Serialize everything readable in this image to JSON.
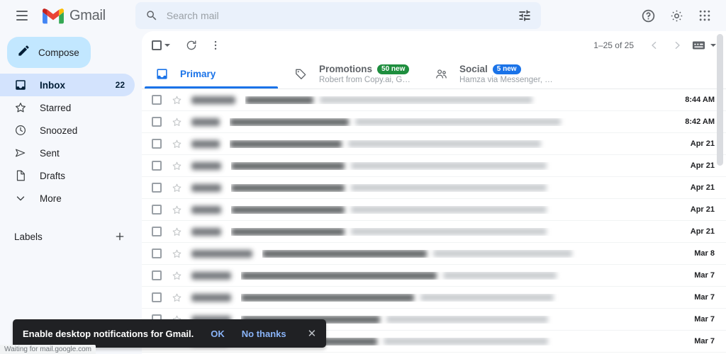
{
  "header": {
    "menu_icon": "hamburger-icon",
    "logo_text": "Gmail",
    "logo_icon": "gmail-m-icon",
    "search": {
      "placeholder": "Search mail",
      "value": "",
      "search_icon": "search-icon",
      "filter_icon": "tune-filter-icon"
    },
    "help_icon": "help-circle-icon",
    "settings_icon": "gear-icon",
    "apps_icon": "apps-grid-icon"
  },
  "sidebar": {
    "compose": {
      "label": "Compose",
      "icon": "pencil-icon"
    },
    "items": [
      {
        "label": "Inbox",
        "icon": "inbox-icon",
        "count": "22",
        "active": true
      },
      {
        "label": "Starred",
        "icon": "star-icon",
        "count": "",
        "active": false
      },
      {
        "label": "Snoozed",
        "icon": "clock-icon",
        "count": "",
        "active": false
      },
      {
        "label": "Sent",
        "icon": "send-icon",
        "count": "",
        "active": false
      },
      {
        "label": "Drafts",
        "icon": "draft-icon",
        "count": "",
        "active": false
      },
      {
        "label": "More",
        "icon": "chevron-down-icon",
        "count": "",
        "active": false
      }
    ],
    "labels": {
      "title": "Labels",
      "add_icon": "plus-icon"
    }
  },
  "toolbar": {
    "select_all_icon": "checkbox-icon",
    "select_dropdown_icon": "caret-down-icon",
    "refresh_icon": "refresh-icon",
    "more_icon": "more-vertical-icon",
    "pagination": "1–25 of 25",
    "prev_icon": "chevron-left-icon",
    "next_icon": "chevron-right-icon",
    "input_tools_icon": "keyboard-icon",
    "input_tools_caret": "caret-down-icon"
  },
  "tabs": [
    {
      "name": "Primary",
      "icon": "inbox-tab-icon",
      "badge": "",
      "badge_color": "",
      "subtitle": "",
      "active": true
    },
    {
      "name": "Promotions",
      "icon": "tag-tab-icon",
      "badge": "50 new",
      "badge_color": "#1e8e3e",
      "subtitle": "Robert from Copy.ai, Garrett fro...",
      "active": false
    },
    {
      "name": "Social",
      "icon": "people-tab-icon",
      "badge": "5 new",
      "badge_color": "#1a73e8",
      "subtitle": "Hamza via Messenger, Facebook",
      "active": false
    }
  ],
  "mail_rows": [
    {
      "date": "8:44 AM",
      "sender_w": 62,
      "subject_w": 96,
      "snippet_w": 300
    },
    {
      "date": "8:42 AM",
      "sender_w": 40,
      "subject_w": 168,
      "snippet_w": 290
    },
    {
      "date": "Apr 21",
      "sender_w": 40,
      "subject_w": 158,
      "snippet_w": 272
    },
    {
      "date": "Apr 21",
      "sender_w": 42,
      "subject_w": 160,
      "snippet_w": 276
    },
    {
      "date": "Apr 21",
      "sender_w": 42,
      "subject_w": 160,
      "snippet_w": 276
    },
    {
      "date": "Apr 21",
      "sender_w": 42,
      "subject_w": 160,
      "snippet_w": 276
    },
    {
      "date": "Apr 21",
      "sender_w": 42,
      "subject_w": 160,
      "snippet_w": 276
    },
    {
      "date": "Mar 8",
      "sender_w": 86,
      "subject_w": 232,
      "snippet_w": 196
    },
    {
      "date": "Mar 7",
      "sender_w": 56,
      "subject_w": 276,
      "snippet_w": 160
    },
    {
      "date": "Mar 7",
      "sender_w": 56,
      "subject_w": 244,
      "snippet_w": 188
    },
    {
      "date": "Mar 7",
      "sender_w": 56,
      "subject_w": 196,
      "snippet_w": 228
    },
    {
      "date": "Mar 7",
      "sender_w": 52,
      "subject_w": 196,
      "snippet_w": 232
    }
  ],
  "toast": {
    "message": "Enable desktop notifications for Gmail.",
    "ok_label": "OK",
    "dismiss_label": "No thanks",
    "close_icon": "close-icon"
  },
  "statusbar": {
    "text": "Waiting for mail.google.com"
  },
  "colors": {
    "accent_blue": "#1a73e8",
    "compose_bg": "#c2e7ff",
    "active_nav_bg": "#d3e3fd",
    "page_bg": "#f6f8fc",
    "promotions_badge": "#1e8e3e",
    "social_badge": "#1a73e8"
  }
}
